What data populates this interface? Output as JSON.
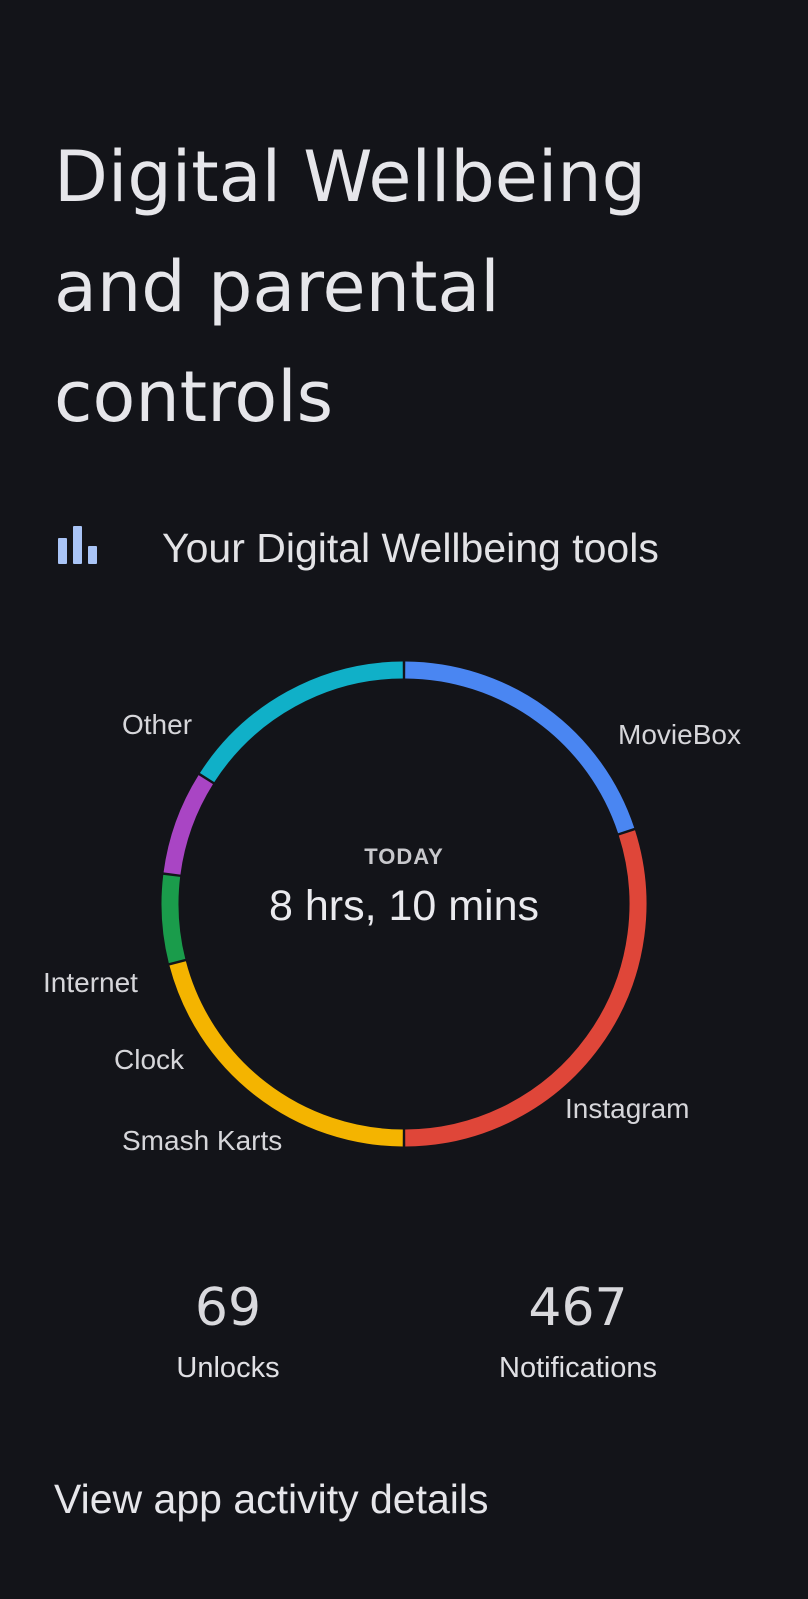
{
  "page": {
    "title": "Digital Wellbeing and parental controls"
  },
  "tools": {
    "icon": "bar-chart-icon",
    "label": "Your Digital Wellbeing tools",
    "icon_color": "#a9c4f6"
  },
  "usage": {
    "caption": "TODAY",
    "total": "8 hrs, 10 mins"
  },
  "chart_data": {
    "type": "pie",
    "segments": [
      {
        "name": "MovieBox",
        "fraction": 0.2,
        "color": "#4a86f2"
      },
      {
        "name": "Instagram",
        "fraction": 0.3,
        "color": "#df4639"
      },
      {
        "name": "Smash Karts",
        "fraction": 0.21,
        "color": "#f4b400"
      },
      {
        "name": "Clock",
        "fraction": 0.06,
        "color": "#1a9c4b"
      },
      {
        "name": "Internet",
        "fraction": 0.07,
        "color": "#a945c4"
      },
      {
        "name": "Other",
        "fraction": 0.16,
        "color": "#10b0c8"
      }
    ]
  },
  "stats": {
    "unlocks": {
      "value": "69",
      "label": "Unlocks"
    },
    "notifications": {
      "value": "467",
      "label": "Notifications"
    }
  },
  "activity": {
    "link_label": "View app activity details"
  }
}
